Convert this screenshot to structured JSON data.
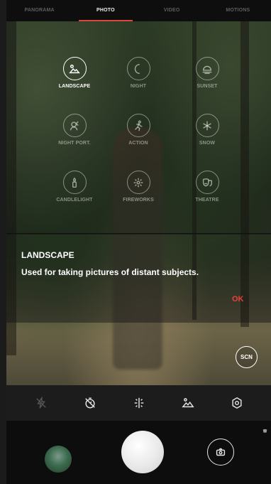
{
  "modes": [
    "PANORAMA",
    "PHOTO",
    "VIDEO",
    "MOTIONS"
  ],
  "active_mode": "PHOTO",
  "scenes": [
    {
      "label": "LANDSCAPE",
      "icon": "landscape-icon",
      "selected": true
    },
    {
      "label": "NIGHT",
      "icon": "night-moon-icon",
      "selected": false
    },
    {
      "label": "SUNSET",
      "icon": "sunset-icon",
      "selected": false
    },
    {
      "label": "NIGHT PORT.",
      "icon": "night-portrait-icon",
      "selected": false
    },
    {
      "label": "ACTION",
      "icon": "action-runner-icon",
      "selected": false
    },
    {
      "label": "SNOW",
      "icon": "snowflake-icon",
      "selected": false
    },
    {
      "label": "CANDLELIGHT",
      "icon": "candle-icon",
      "selected": false
    },
    {
      "label": "FIREWORKS",
      "icon": "fireworks-icon",
      "selected": false
    },
    {
      "label": "THEATRE",
      "icon": "theatre-masks-icon",
      "selected": false
    }
  ],
  "info": {
    "title": "LANDSCAPE",
    "description": "Used for taking pictures of distant subjects.",
    "ok_label": "OK"
  },
  "scn_label": "SCN",
  "toolbar": {
    "icons": [
      "flash-off-icon",
      "timer-off-icon",
      "hdr-icon",
      "scene-landscape-icon",
      "settings-gear-icon"
    ]
  },
  "colors": {
    "accent": "#e0453c",
    "ok": "#e8413a"
  }
}
